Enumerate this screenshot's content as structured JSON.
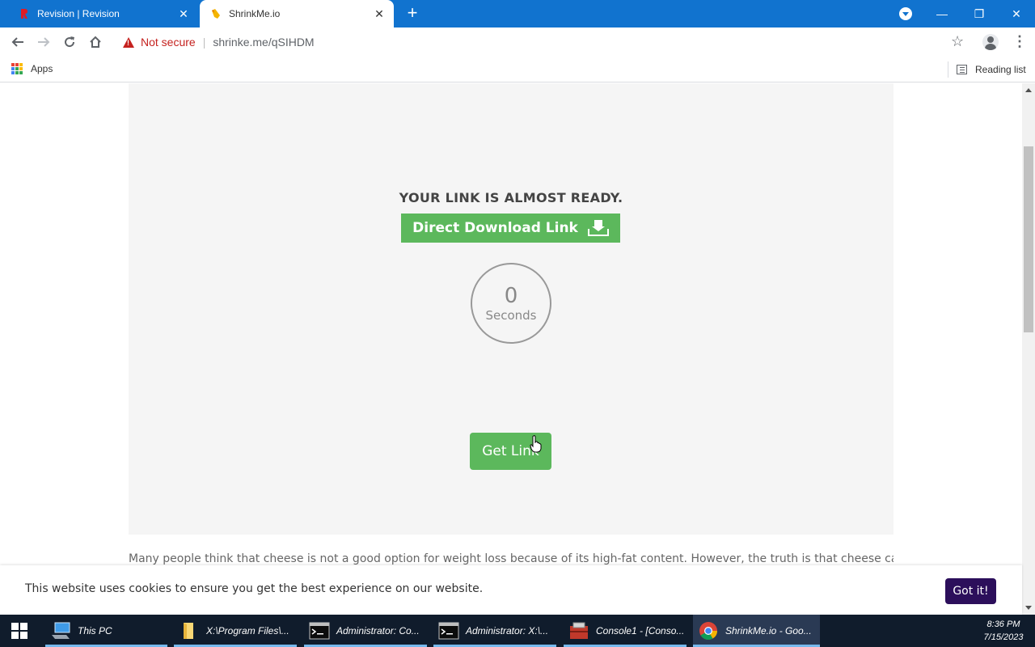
{
  "browser": {
    "tabs": [
      {
        "title": "Revision | Revision",
        "active": false
      },
      {
        "title": "ShrinkMe.io",
        "active": true
      }
    ],
    "security_label": "Not secure",
    "url": "shrinke.me/qSIHDM",
    "bookmarks": {
      "apps_label": "Apps",
      "reading_list_label": "Reading list"
    }
  },
  "page": {
    "headline": "YOUR LINK IS ALMOST READY.",
    "download_button_label": "Direct Download Link",
    "timer": {
      "value": "0",
      "unit_label": "Seconds"
    },
    "get_link_label": "Get Link",
    "body_text": "Many people think that cheese is not a good option for weight loss because of its high-fat content. However, the truth is that cheese can be an",
    "cookie_notice": {
      "text": "This website uses cookies to ensure you get the best experience on our website.",
      "button_label": "Got it!"
    }
  },
  "taskbar": {
    "items": [
      {
        "label": "This PC",
        "icon": "computer-icon"
      },
      {
        "label": "X:\\Program Files\\...",
        "icon": "folder-icon"
      },
      {
        "label": "Administrator: Co...",
        "icon": "cmd-icon"
      },
      {
        "label": "Administrator: X:\\...",
        "icon": "cmd-icon"
      },
      {
        "label": "Console1 - [Conso...",
        "icon": "mmc-icon"
      },
      {
        "label": "ShrinkMe.io - Goo...",
        "icon": "chrome-icon"
      }
    ],
    "time": "8:36 PM",
    "date": "7/15/2023"
  },
  "colors": {
    "tabstrip": "#1173cf",
    "button_green": "#5cb85c",
    "cookie_button": "#2c0f5b",
    "not_secure_red": "#c5221f",
    "taskbar": "#101c2c"
  }
}
